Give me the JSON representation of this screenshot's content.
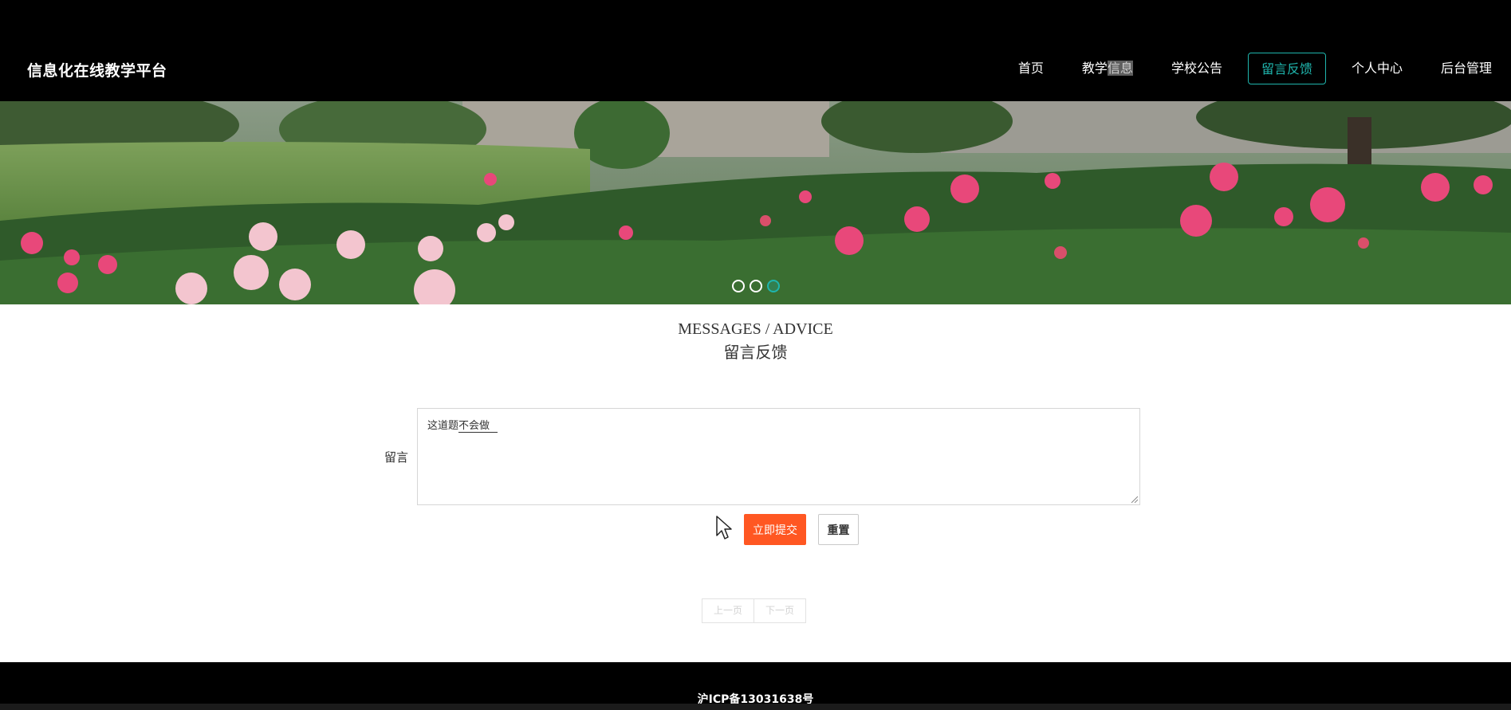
{
  "header": {
    "brand": "信息化在线教学平台",
    "nav": [
      {
        "label": "首页"
      },
      {
        "label_prefix": "教学",
        "label_highlight": "信息"
      },
      {
        "label": "学校公告"
      },
      {
        "label": "留言反馈",
        "active": true
      },
      {
        "label": "个人中心"
      },
      {
        "label": "后台管理"
      }
    ]
  },
  "banner": {
    "image": "peony-garden-photo",
    "slides": 3,
    "active_slide": 3
  },
  "section": {
    "title_en": "MESSAGES / ADVICE",
    "title_cn": "留言反馈"
  },
  "form": {
    "message_label": "留言",
    "message_value_plain": "这道题",
    "message_value_underlined": "不会做",
    "submit_label": "立即提交",
    "reset_label": "重置"
  },
  "pager": {
    "prev_label": "上一页",
    "next_label": "下一页"
  },
  "footer": {
    "icp": "沪ICP备13031638号"
  },
  "colors": {
    "accent": "#1fb5ad",
    "submit": "#ff5722",
    "header_bg": "#000000"
  }
}
